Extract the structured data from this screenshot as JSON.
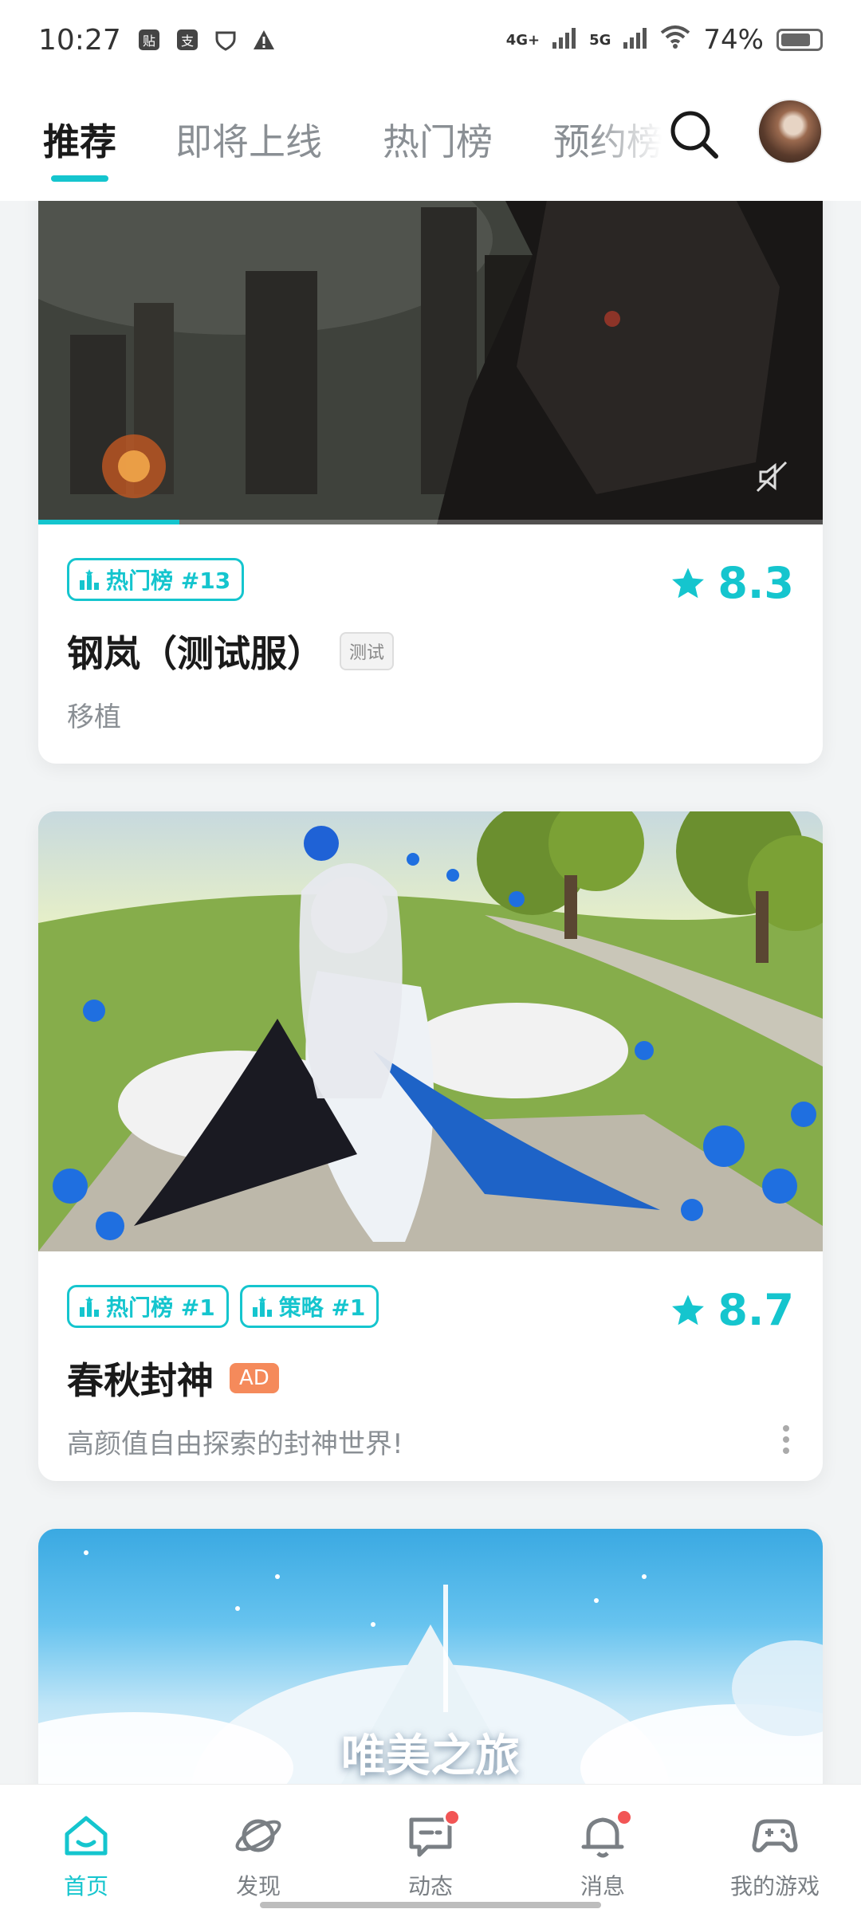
{
  "status_bar": {
    "time": "10:27",
    "network_1": "4G+",
    "network_2": "5G",
    "battery": "74%"
  },
  "top_nav": {
    "tabs": [
      {
        "label": "推荐",
        "active": true
      },
      {
        "label": "即将上线",
        "active": false
      },
      {
        "label": "热门榜",
        "active": false
      },
      {
        "label": "预约榜",
        "active": false
      }
    ],
    "accent_color": "#15c5ce"
  },
  "cards": [
    {
      "tags": [
        "热门榜 #13"
      ],
      "rating": "8.3",
      "title": "钢岚（测试服）",
      "badge": "测试",
      "subtitle": "移植",
      "video_progress": 0.18
    },
    {
      "tags": [
        "热门榜 #1",
        "策略 #1"
      ],
      "rating": "8.7",
      "title": "春秋封神",
      "badge": "AD",
      "subtitle": "高颜值自由探索的封神世界!"
    },
    {
      "overlay_text": "唯美之旅"
    }
  ],
  "bottom_nav": [
    {
      "label": "首页",
      "icon": "home-icon",
      "active": true
    },
    {
      "label": "发现",
      "icon": "planet-icon",
      "active": false
    },
    {
      "label": "动态",
      "icon": "chat-icon",
      "active": false,
      "dot": true
    },
    {
      "label": "消息",
      "icon": "bell-icon",
      "active": false,
      "dot": true
    },
    {
      "label": "我的游戏",
      "icon": "gamepad-icon",
      "active": false
    }
  ]
}
